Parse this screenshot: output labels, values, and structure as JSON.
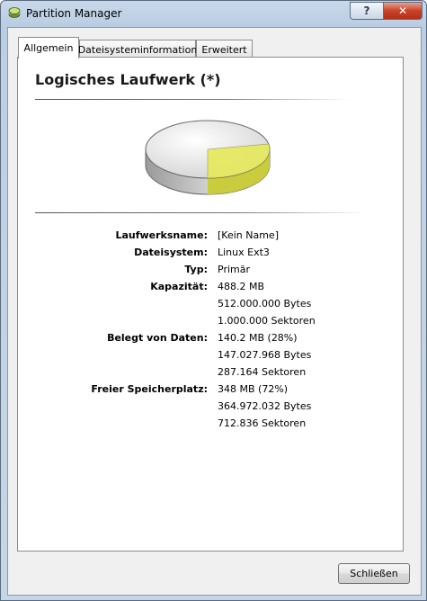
{
  "window": {
    "title": "Partition Manager",
    "help_glyph": "?",
    "close_glyph": "✕"
  },
  "tabs": [
    {
      "label": "Allgemein",
      "active": true
    },
    {
      "label": "Dateisysteminformation",
      "active": false
    },
    {
      "label": "Erweitert",
      "active": false
    }
  ],
  "panel": {
    "heading": "Logisches Laufwerk (*)",
    "chart_data": {
      "type": "pie",
      "slices": [
        {
          "name": "Belegt von Daten",
          "value": 28,
          "color": "#e6e85a"
        },
        {
          "name": "Freier Speicherplatz",
          "value": 72,
          "color": "#e4e4e4"
        }
      ]
    }
  },
  "properties": [
    {
      "label": "Laufwerksname:",
      "values": [
        "[Kein Name]"
      ]
    },
    {
      "label": "Dateisystem:",
      "values": [
        "Linux Ext3"
      ]
    },
    {
      "label": "Typ:",
      "values": [
        "Primär"
      ]
    },
    {
      "label": "Kapazität:",
      "values": [
        "488.2 MB",
        "512.000.000 Bytes",
        "1.000.000 Sektoren"
      ]
    },
    {
      "label": "Belegt von Daten:",
      "values": [
        "140.2 MB (28%)",
        "147.027.968 Bytes",
        "287.164 Sektoren"
      ]
    },
    {
      "label": "Freier Speicherplatz:",
      "values": [
        "348 MB (72%)",
        "364.972.032 Bytes",
        "712.836 Sektoren"
      ]
    }
  ],
  "buttons": {
    "close_label": "Schließen"
  }
}
